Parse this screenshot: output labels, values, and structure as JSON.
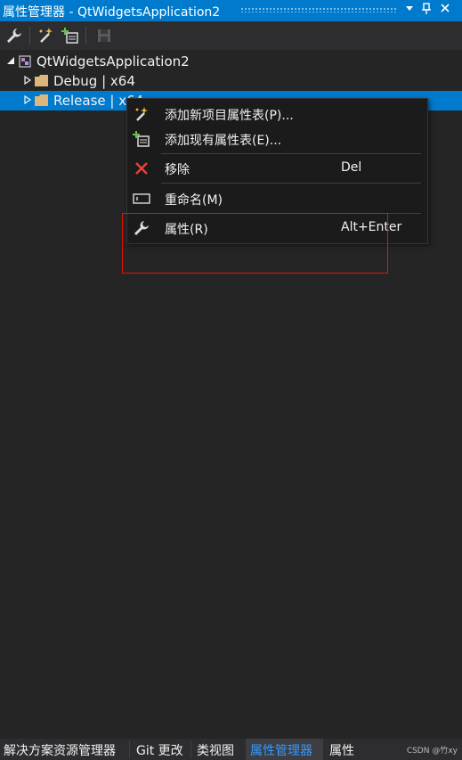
{
  "window": {
    "title": "属性管理器 - QtWidgetsApplication2",
    "buttons": {
      "dropdown": "▾",
      "pin": "pin-icon",
      "close": "✕"
    }
  },
  "toolbar": {
    "buttons": [
      "properties-wrench-icon",
      "add-new-property-sheet-icon",
      "add-existing-property-sheet-icon",
      "save-icon"
    ]
  },
  "tree": {
    "root": {
      "label": "QtWidgetsApplication2",
      "expanded": true
    },
    "children": [
      {
        "label": "Debug | x64",
        "expanded": false,
        "selected": false
      },
      {
        "label": "Release | x64",
        "expanded": false,
        "selected": true
      }
    ]
  },
  "context_menu": {
    "items": [
      {
        "label": "添加新项目属性表(P)...",
        "shortcut": "",
        "icon": "new-property-sheet-icon"
      },
      {
        "label": "添加现有属性表(E)...",
        "shortcut": "",
        "icon": "existing-property-sheet-icon"
      },
      {
        "label": "移除",
        "shortcut": "Del",
        "icon": "remove-x-icon"
      },
      {
        "label": "重命名(M)",
        "shortcut": "",
        "icon": "rename-icon"
      },
      {
        "label": "属性(R)",
        "shortcut": "Alt+Enter",
        "icon": "wrench-icon"
      }
    ],
    "highlight_color": "#e51400"
  },
  "bottom_tabs": [
    {
      "label": "解决方案资源管理器",
      "active": false
    },
    {
      "label": "Git 更改",
      "active": false
    },
    {
      "label": "类视图",
      "active": false
    },
    {
      "label": "属性管理器",
      "active": true
    },
    {
      "label": "属性",
      "active": false
    }
  ],
  "watermark": "CSDN @竹xy",
  "colors": {
    "accent": "#007acc",
    "background": "#252526",
    "active_tab_text": "#3399ff"
  }
}
